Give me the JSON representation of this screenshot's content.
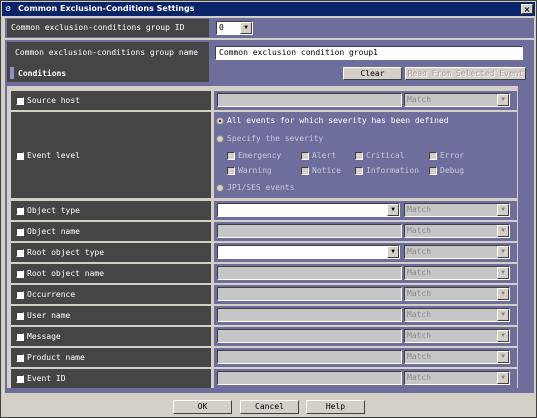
{
  "window": {
    "title": "Common Exclusion-Conditions Settings",
    "close": "×",
    "app_icon": "⚙"
  },
  "group_id": {
    "label": "Common exclusion-conditions group ID",
    "value": "0"
  },
  "group_name": {
    "label": "Common exclusion-conditions group name",
    "value": "Common exclusion condition group1"
  },
  "conditions": {
    "header": "Conditions",
    "clear_label": "Clear",
    "read_label": "Read From Selected Event"
  },
  "match_text": "Match",
  "rows": [
    {
      "label": "Source host"
    },
    {
      "label": "Event level"
    },
    {
      "label": "Object type"
    },
    {
      "label": "Object name"
    },
    {
      "label": "Root object type"
    },
    {
      "label": "Root object name"
    },
    {
      "label": "Occurrence"
    },
    {
      "label": "User name"
    },
    {
      "label": "Message"
    },
    {
      "label": "Product name"
    },
    {
      "label": "Event ID"
    }
  ],
  "event_level": {
    "opt_all": "All events for which severity has been defined",
    "opt_specify": "Specify the severity",
    "opt_jp1": "JP1/SES events",
    "severities": [
      "Emergency",
      "Alert",
      "Critical",
      "Error",
      "Warning",
      "Notice",
      "Information",
      "Debug"
    ]
  },
  "footer": {
    "ok": "OK",
    "cancel": "Cancel",
    "help": "Help"
  }
}
